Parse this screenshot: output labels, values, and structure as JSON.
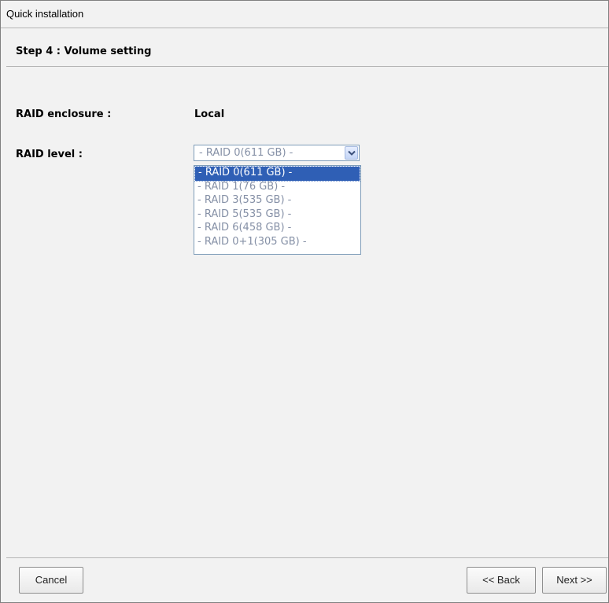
{
  "window": {
    "title": "Quick installation"
  },
  "step": {
    "title": "Step 4 : Volume setting"
  },
  "form": {
    "enclosure_label": "RAID enclosure :",
    "enclosure_value": "Local",
    "level_label": "RAID level :",
    "level_selected": "- RAID 0(611 GB) -",
    "level_options": [
      "- RAID 0(611 GB) -",
      "- RAID 1(76 GB) -",
      "- RAID 3(535 GB) -",
      "- RAID 5(535 GB) -",
      "- RAID 6(458 GB) -",
      "- RAID 0+1(305 GB) -"
    ],
    "highlighted_option_index": 0
  },
  "buttons": {
    "cancel": "Cancel",
    "back": "<< Back",
    "next": "Next >>"
  },
  "colors": {
    "highlight": "#2f5fb5",
    "option_text": "#8590a6",
    "panel_bg": "#f2f2f2"
  }
}
